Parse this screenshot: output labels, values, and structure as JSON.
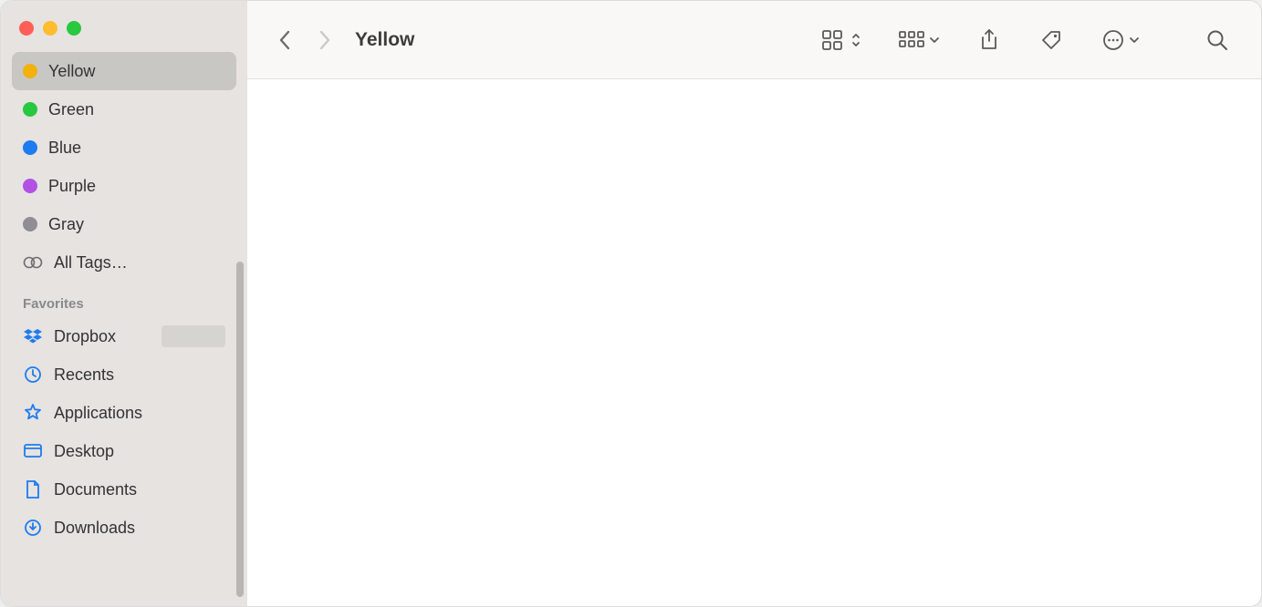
{
  "window": {
    "title": "Yellow"
  },
  "traffic": {
    "close": "#ff5f57",
    "minimize": "#febc2e",
    "maximize": "#28c840"
  },
  "sidebar": {
    "tags": [
      {
        "label": "Yellow",
        "color": "#f2b20b",
        "selected": true
      },
      {
        "label": "Green",
        "color": "#28c840",
        "selected": false
      },
      {
        "label": "Blue",
        "color": "#1e7bf0",
        "selected": false
      },
      {
        "label": "Purple",
        "color": "#b152e4",
        "selected": false
      },
      {
        "label": "Gray",
        "color": "#8e8e93",
        "selected": false
      }
    ],
    "all_tags_label": "All Tags…",
    "favorites_header": "Favorites",
    "favorites": [
      {
        "label": "Dropbox",
        "icon": "dropbox",
        "badge": true
      },
      {
        "label": "Recents",
        "icon": "clock",
        "badge": false
      },
      {
        "label": "Applications",
        "icon": "apps",
        "badge": false
      },
      {
        "label": "Desktop",
        "icon": "desktop",
        "badge": false
      },
      {
        "label": "Documents",
        "icon": "document",
        "badge": false
      },
      {
        "label": "Downloads",
        "icon": "download",
        "badge": false
      }
    ]
  },
  "toolbar": {
    "back_enabled": true,
    "forward_enabled": false,
    "title": "Yellow"
  }
}
